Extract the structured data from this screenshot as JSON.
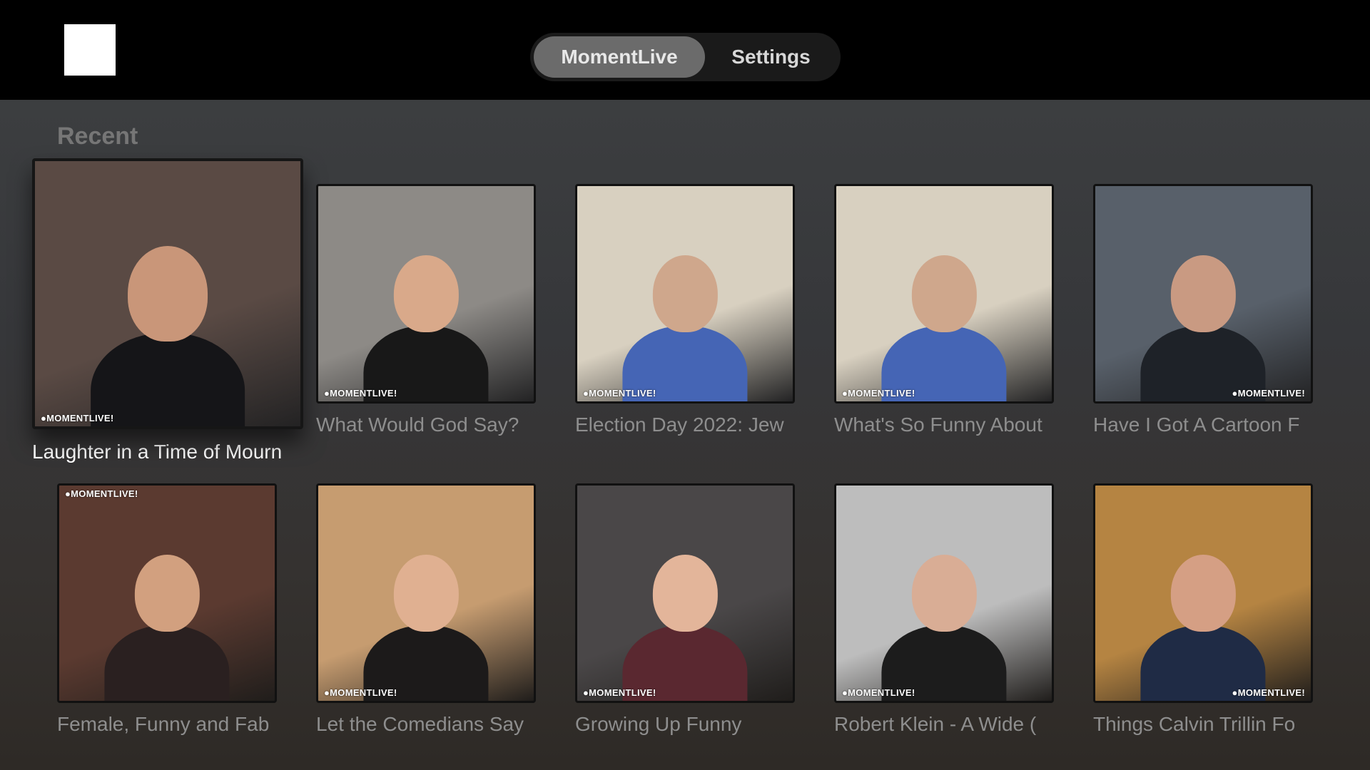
{
  "nav": {
    "tabs": [
      {
        "label": "MomentLive",
        "active": true
      },
      {
        "label": "Settings",
        "active": false
      }
    ]
  },
  "section": {
    "title": "Recent"
  },
  "watermark_text": "MOMENTLIVE!",
  "tiles": [
    {
      "label": "Laughter in a Time of Mourn",
      "focused": true,
      "bg": "#5a4a44",
      "head": "#c99679",
      "body": "#151518"
    },
    {
      "label": "What Would God Say?",
      "bg": "#8d8a86",
      "head": "#d9a98a",
      "body": "#181818"
    },
    {
      "label": "Election Day 2022: Jew",
      "bg": "#d8d0c0",
      "head": "#cfa78c",
      "body": "#4565b5"
    },
    {
      "label": "What's So Funny About",
      "bg": "#d8d0c0",
      "head": "#cfa78c",
      "body": "#4565b5"
    },
    {
      "label": "Have I Got A Cartoon F",
      "bg": "#58606a",
      "head": "#c99a82",
      "body": "#1e2228"
    },
    {
      "label": "Female, Funny and Fab",
      "bg": "#5b3a30",
      "head": "#d2a07f",
      "body": "#2a2020"
    },
    {
      "label": "Let the Comedians Say",
      "bg": "#c69c70",
      "head": "#e0b091",
      "body": "#1c1a1a"
    },
    {
      "label": "Growing Up Funny",
      "bg": "#4a4748",
      "head": "#e3b59a",
      "body": "#5a2830"
    },
    {
      "label": "Robert Klein - A Wide (",
      "bg": "#bdbdbd",
      "head": "#d9ad95",
      "body": "#1c1c1c"
    },
    {
      "label": "Things Calvin Trillin Fo",
      "bg": "#b58442",
      "head": "#d59f84",
      "body": "#1f2b45"
    }
  ]
}
